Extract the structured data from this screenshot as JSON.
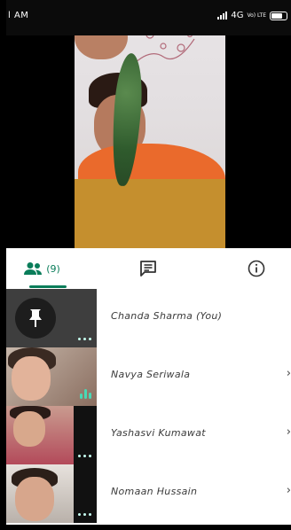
{
  "status_bar": {
    "time": "l AM",
    "network_text": "4G",
    "volte_text": "Vo) LTE"
  },
  "tabs": [
    {
      "name": "people",
      "icon": "people-icon",
      "count": "(9)",
      "active": true
    },
    {
      "name": "chat",
      "icon": "chat-icon",
      "active": false
    },
    {
      "name": "info",
      "icon": "info-icon",
      "active": false
    }
  ],
  "colors": {
    "accent": "#0a7d5a",
    "speaking": "#48d9b5"
  },
  "participants": [
    {
      "name": "Chanda Sharma (You)",
      "pinned": true,
      "status": "more"
    },
    {
      "name": "Navya Seriwala",
      "status": "speaking"
    },
    {
      "name": "Yashasvi Kumawat",
      "status": "more"
    },
    {
      "name": "Nomaan Hussain",
      "status": "more"
    }
  ]
}
